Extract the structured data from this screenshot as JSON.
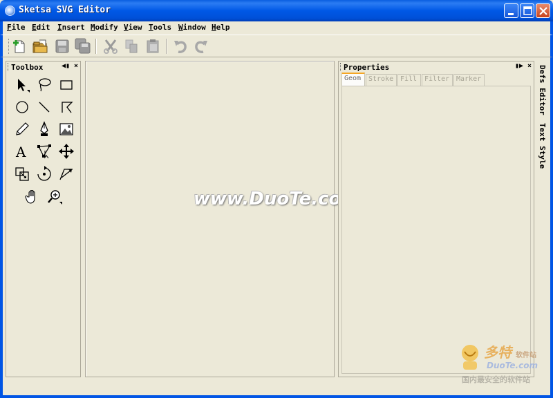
{
  "window": {
    "title": "Sketsa SVG Editor",
    "minimize_glyph": "_",
    "maximize_glyph": "□",
    "close_glyph": "×"
  },
  "menu": [
    {
      "key": "F",
      "rest": "ile"
    },
    {
      "key": "E",
      "rest": "dit"
    },
    {
      "key": "I",
      "rest": "nsert"
    },
    {
      "key": "M",
      "rest": "odify"
    },
    {
      "key": "V",
      "rest": "iew"
    },
    {
      "key": "T",
      "rest": "ools"
    },
    {
      "key": "W",
      "rest": "indow"
    },
    {
      "key": "H",
      "rest": "elp"
    }
  ],
  "toolbar": {
    "buttons": [
      "new-icon",
      "open-icon",
      "save-icon",
      "save-all-icon",
      "cut-icon",
      "copy-icon",
      "paste-icon",
      "undo-icon",
      "redo-icon"
    ]
  },
  "toolbox": {
    "title": "Toolbox",
    "pin_glyph": "◀▮",
    "close_glyph": "×",
    "tools": [
      "select-icon",
      "lasso-icon",
      "rectangle-icon",
      "ellipse-icon",
      "line-icon",
      "polyline-icon",
      "pencil-icon",
      "pen-icon",
      "image-icon",
      "text-icon",
      "node-edit-icon",
      "move-icon",
      "scale-icon",
      "rotate-icon",
      "skew-icon",
      "hand-icon",
      "zoom-icon"
    ]
  },
  "canvas": {
    "watermark": "www.DuoTe.com"
  },
  "properties": {
    "title": "Properties",
    "pin_glyph": "▮▶",
    "close_glyph": "×",
    "tabs": [
      "Geom",
      "Stroke",
      "Fill",
      "Filter",
      "Marker"
    ]
  },
  "side_tabs": {
    "defs_editor": "Defs Editor",
    "text_style": "Text Style"
  },
  "logo": {
    "brand_cn": "多特",
    "brand_small": "软件站",
    "brand_en": "DuoTe.com",
    "slogan": "国内最安全的软件站"
  },
  "colors": {
    "xp_blue": "#0055e5",
    "panel_bg": "#ece9d8",
    "tab_accent": "#f5a623"
  }
}
